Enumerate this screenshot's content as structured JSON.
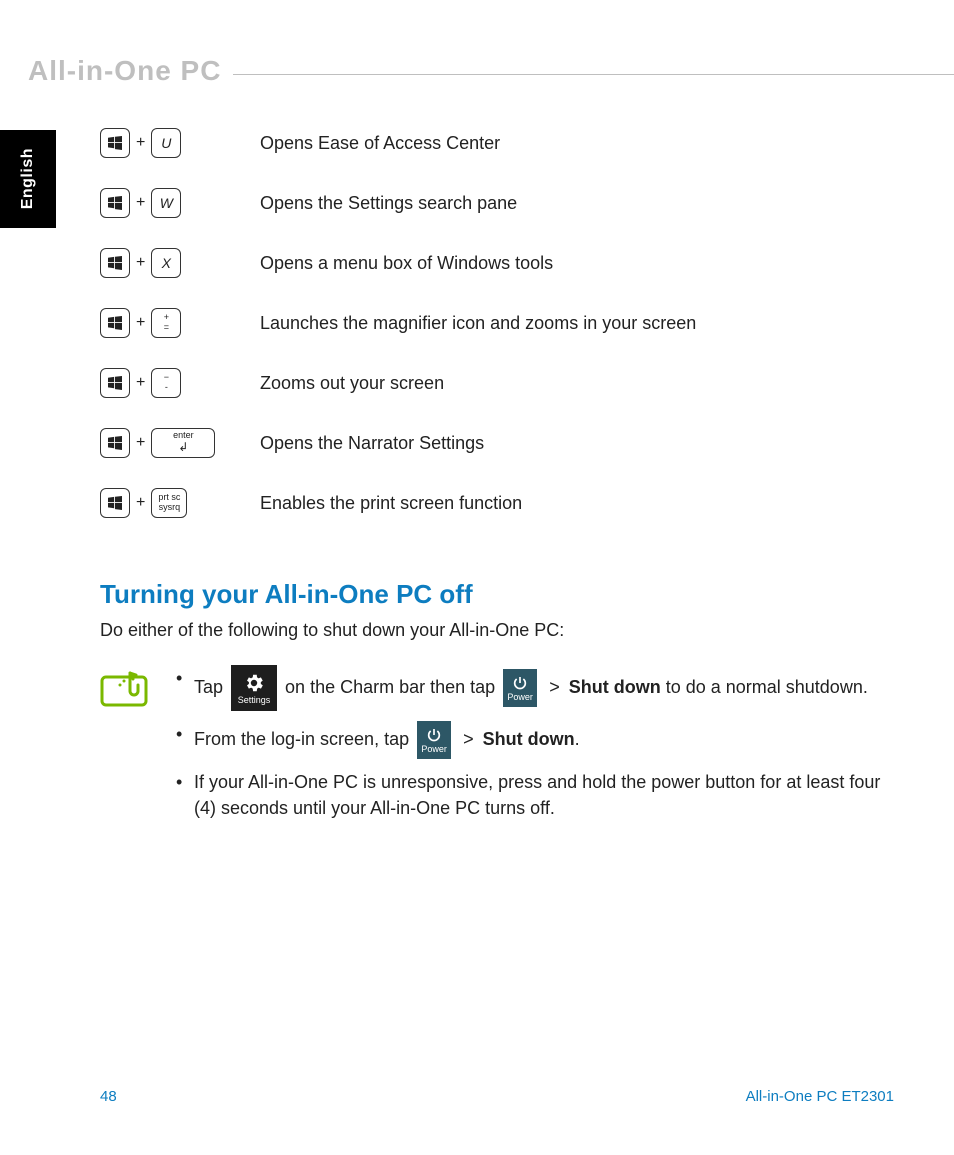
{
  "header": {
    "title": "All-in-One PC"
  },
  "language_tab": "English",
  "shortcuts": [
    {
      "key2_label": "U",
      "key2_class": "",
      "desc": "Opens Ease of Access Center"
    },
    {
      "key2_label": "W",
      "key2_class": "",
      "desc": "Opens the Settings search pane"
    },
    {
      "key2_label": "X",
      "key2_class": "",
      "desc": "Opens a menu box of Windows tools"
    },
    {
      "key2_label": "+ =",
      "key2_class": "small-txt",
      "desc": "Launches the magnifier icon and zooms in your screen"
    },
    {
      "key2_label": "− -",
      "key2_class": "small-txt",
      "desc": "Zooms out your screen"
    },
    {
      "key2_label": "enter",
      "key2_class": "wide",
      "desc": "Opens the Narrator Settings"
    },
    {
      "key2_label": "prt sc\nsysrq",
      "key2_class": "small-txt",
      "desc": "Enables the print screen function"
    }
  ],
  "section": {
    "heading": "Turning your All-in-One PC off",
    "intro": "Do either of the following to shut down your All-in-One PC:",
    "steps": {
      "s1a": "Tap ",
      "s1b": " on the Charm bar then tap ",
      "s1c": " > ",
      "s1d": "Shut down",
      "s1e": " to do a normal shutdown.",
      "s2a": "From the log-in screen, tap ",
      "s2b": " > ",
      "s2c": "Shut down",
      "s2d": ".",
      "s3": "If your All-in-One PC is unresponsive, press and hold the power button for at least four (4) seconds until your All-in-One PC turns off."
    },
    "icon_labels": {
      "settings": "Settings",
      "power": "Power"
    }
  },
  "footer": {
    "page": "48",
    "model": "All-in-One PC ET2301"
  }
}
